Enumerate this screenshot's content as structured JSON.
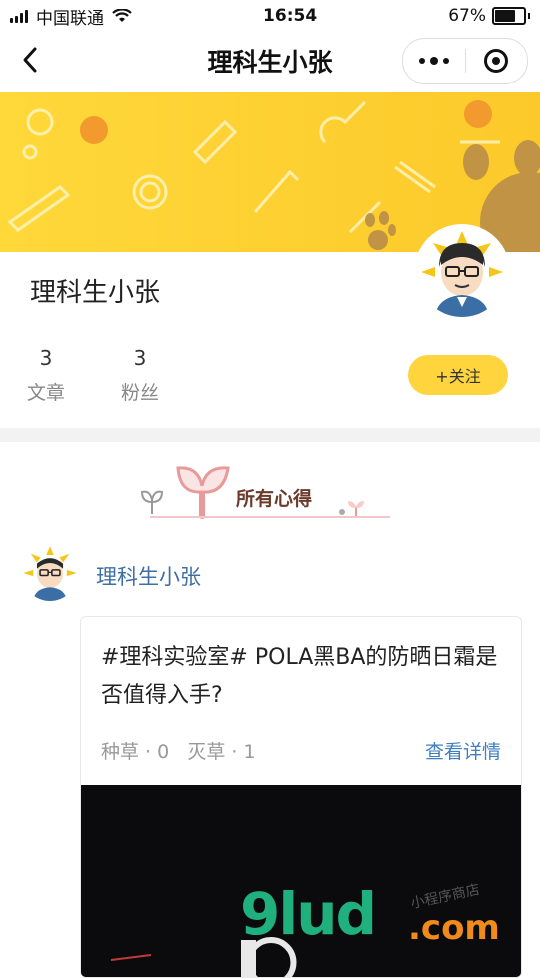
{
  "status": {
    "carrier": "中国联通",
    "time": "16:54",
    "battery": "67%",
    "battery_level": 0.67
  },
  "nav": {
    "title": "理科生小张"
  },
  "profile": {
    "name": "理科生小张",
    "stats": [
      {
        "value": "3",
        "label": "文章"
      },
      {
        "value": "3",
        "label": "粉丝"
      }
    ],
    "follow_label": "+关注"
  },
  "section": {
    "title": "所有心得"
  },
  "post": {
    "author": "理科生小张",
    "text": "#理科实验室# POLA黑BA的防晒日霜是否值得入手?",
    "meta": "种草 · 0   灭草 · 1",
    "detail_link": "查看详情"
  },
  "watermark": {
    "main": "9lud",
    "suffix": ".com",
    "tagline": "小程序商店"
  },
  "colors": {
    "accent": "#ffd43d",
    "link": "#3f7fc0",
    "name": "#3f6fa6"
  }
}
